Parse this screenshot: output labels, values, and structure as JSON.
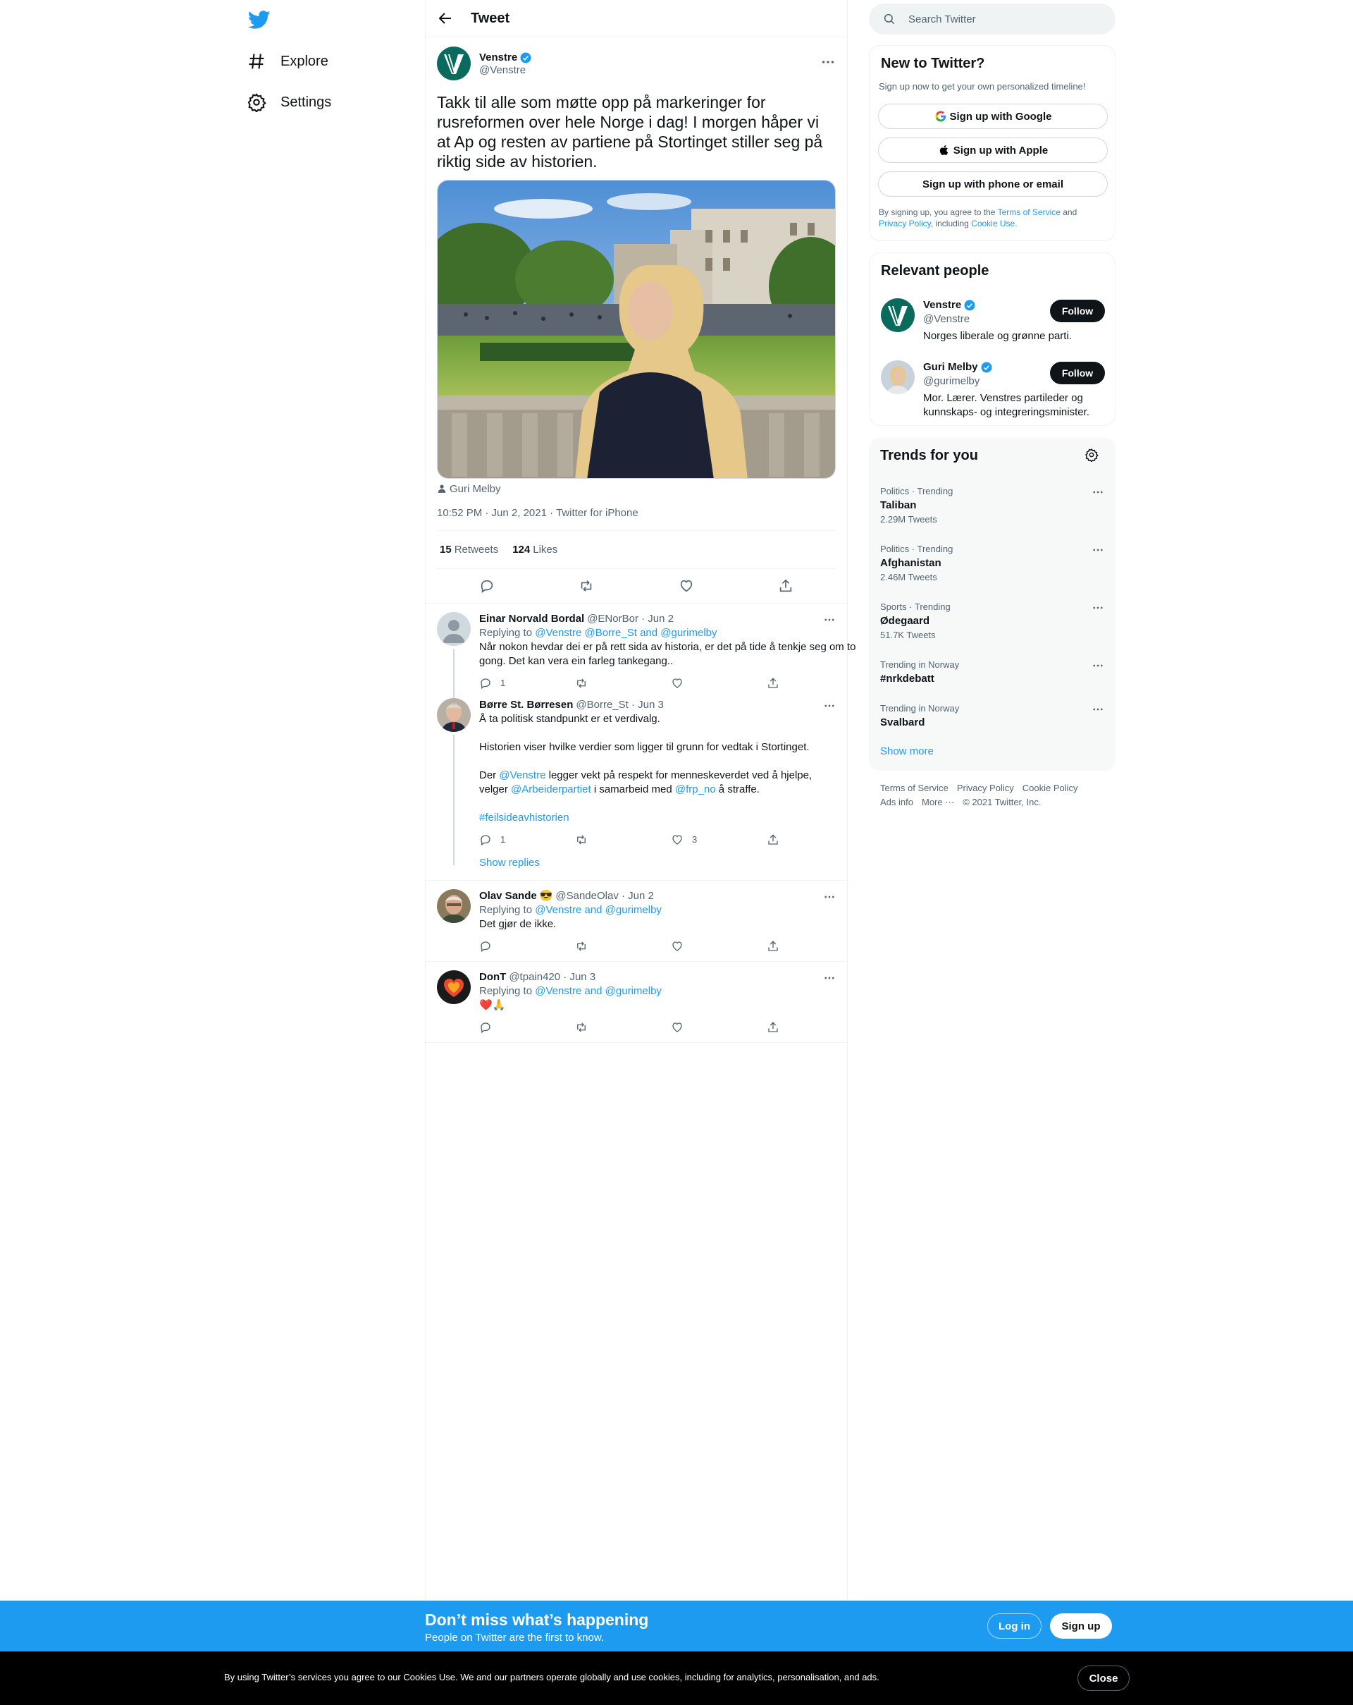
{
  "nav": {
    "items": [
      {
        "label": "Explore",
        "icon": "hashtag-icon"
      },
      {
        "label": "Settings",
        "icon": "gear-icon"
      }
    ]
  },
  "header": {
    "title": "Tweet"
  },
  "tweet": {
    "author_name": "Venstre",
    "author_handle": "@Venstre",
    "text": "Takk til alle som møtte opp på markeringer for rusreformen over hele Norge i dag! I morgen håper vi at Ap og resten av partiene på Stortinget stiller seg på riktig side av historien.",
    "tagged_person": "Guri Melby",
    "timestamp": "10:52 PM · Jun 2, 2021 · Twitter for iPhone",
    "retweets": "15",
    "retweets_label": "Retweets",
    "likes": "124",
    "likes_label": "Likes"
  },
  "replies": [
    {
      "name": "Einar Norvald Bordal",
      "handle_date": "@ENorBor · Jun 2",
      "replying_prefix": "Replying to ",
      "replying_to": "@Venstre @Borre_St and @gurimelby",
      "text": "Når nokon hevdar dei er på rett sida av historia, er det på tide å tenkje seg om to gong. Det kan vera ein farleg tankegang..",
      "reply_count": "1",
      "retweet_count": "",
      "like_count": ""
    },
    {
      "name": "Børre St. Børresen",
      "handle_date": "@Borre_St · Jun 3",
      "line1": "Å ta politisk standpunkt er et verdivalg.",
      "line2": "Historien viser hvilke verdier som ligger til grunn for vedtak i Stortinget.",
      "line3_a": "Der ",
      "line3_b": "@Venstre",
      "line3_c": " legger vekt på respekt for menneskeverdet ved å hjelpe,",
      "line4_a": "velger ",
      "line4_b": "@Arbeiderpartiet",
      "line4_c": " i samarbeid med ",
      "line4_d": "@frp_no",
      "line4_e": " å straffe.",
      "hashtag": "#feilsideavhistorien",
      "reply_count": "1",
      "retweet_count": "",
      "like_count": "3",
      "show_replies": "Show replies"
    },
    {
      "name": "Olav Sande",
      "emoji": "😎",
      "handle_date": "@SandeOlav · Jun 2",
      "replying_prefix": "Replying to ",
      "replying_to": "@Venstre and @gurimelby",
      "text": "Det gjør de ikke."
    },
    {
      "name": "DonT",
      "handle_date": "@tpain420 · Jun 3",
      "replying_prefix": "Replying to ",
      "replying_to": "@Venstre and @gurimelby",
      "text": "❤️🙏"
    }
  ],
  "search": {
    "placeholder": "Search Twitter"
  },
  "new_to_twitter": {
    "title": "New to Twitter?",
    "subtitle": "Sign up now to get your own personalized timeline!",
    "google": "Sign up with Google",
    "apple": "Sign up with Apple",
    "phone": "Sign up with phone or email",
    "legal_1": "By signing up, you agree to the ",
    "tos": "Terms of Service",
    "legal_2": " and",
    "privacy": "Privacy Policy",
    "legal_3": ", including ",
    "cookie": "Cookie Use."
  },
  "relevant": {
    "title": "Relevant people",
    "people": [
      {
        "name": "Venstre",
        "handle": "@Venstre",
        "bio": "Norges liberale og grønne parti.",
        "button": "Follow"
      },
      {
        "name": "Guri Melby",
        "handle": "@gurimelby",
        "bio": "Mor. Lærer. Venstres partileder og kunnskaps- og integreringsminister.",
        "button": "Follow"
      }
    ]
  },
  "trends": {
    "title": "Trends for you",
    "items": [
      {
        "category": "Politics · Trending",
        "topic": "Taliban",
        "count": "2.29M Tweets"
      },
      {
        "category": "Politics · Trending",
        "topic": "Afghanistan",
        "count": "2.46M Tweets"
      },
      {
        "category": "Sports · Trending",
        "topic": "Ødegaard",
        "count": "51.7K Tweets"
      },
      {
        "category": "Trending in Norway",
        "topic": "#nrkdebatt",
        "count": ""
      },
      {
        "category": "Trending in Norway",
        "topic": "Svalbard",
        "count": ""
      }
    ],
    "show_more": "Show more"
  },
  "footer": {
    "tos": "Terms of Service",
    "privacy": "Privacy Policy",
    "cookie": "Cookie Policy",
    "ads": "Ads info",
    "more": "More ···",
    "copyright": "© 2021 Twitter, Inc."
  },
  "banner": {
    "title": "Don’t miss what’s happening",
    "subtitle": "People on Twitter are the first to know.",
    "login": "Log in",
    "signup": "Sign up"
  },
  "cookie_bar": {
    "text": "By using Twitter’s services you agree to our Cookies Use. We and our partners operate globally and use cookies, including for analytics, personalisation, and ads.",
    "close": "Close"
  },
  "colors": {
    "accent": "#1d9bf0",
    "text": "#0f1419",
    "muted": "#536471",
    "border": "#eff3f4"
  }
}
